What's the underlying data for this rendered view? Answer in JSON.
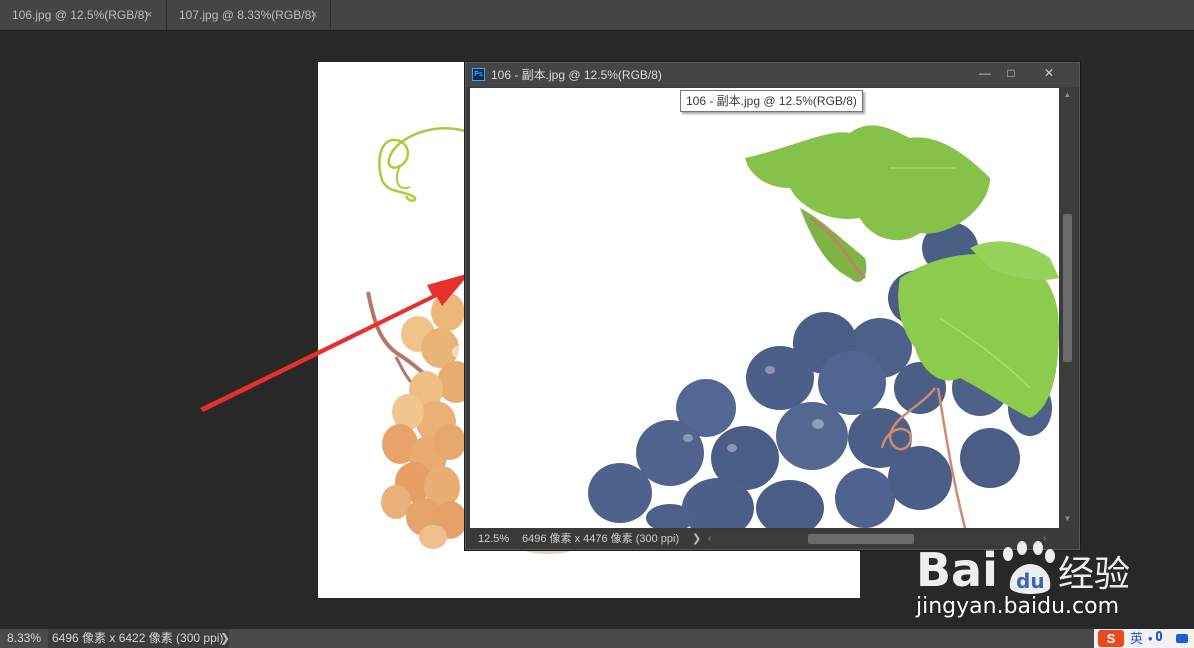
{
  "tabs": [
    {
      "label": "106.jpg @ 12.5%(RGB/8)",
      "close": "×"
    },
    {
      "label": "107.jpg @ 8.33%(RGB/8)",
      "close": "×"
    }
  ],
  "float_window": {
    "app_icon_text": "Ps",
    "title": "106 - 副本.jpg @ 12.5%(RGB/8)",
    "tooltip": "106 - 副本.jpg @ 12.5%(RGB/8)",
    "minimize": "—",
    "restore": "□",
    "close": "✕",
    "zoom": "12.5%",
    "doc_info": "6496 像素 x 4476 像素 (300 ppi)",
    "info_arrow": "❯"
  },
  "status_bar": {
    "zoom": "8.33%",
    "doc_info": "6496 像素 x 6422 像素 (300 ppi)",
    "info_arrow": "❯"
  },
  "ime": {
    "lang_label": "英"
  },
  "watermark": {
    "brand": "Bai",
    "paw": "du",
    "cn_text": "经验",
    "domain": "jingyan.baidu.com"
  },
  "colors": {
    "arrow": "#e8302a",
    "grape_blue": "#4a5d85",
    "grape_amber": "#e6b07a",
    "leaf_green": "#7fbf3a",
    "ps_blue": "#31a8ff"
  }
}
